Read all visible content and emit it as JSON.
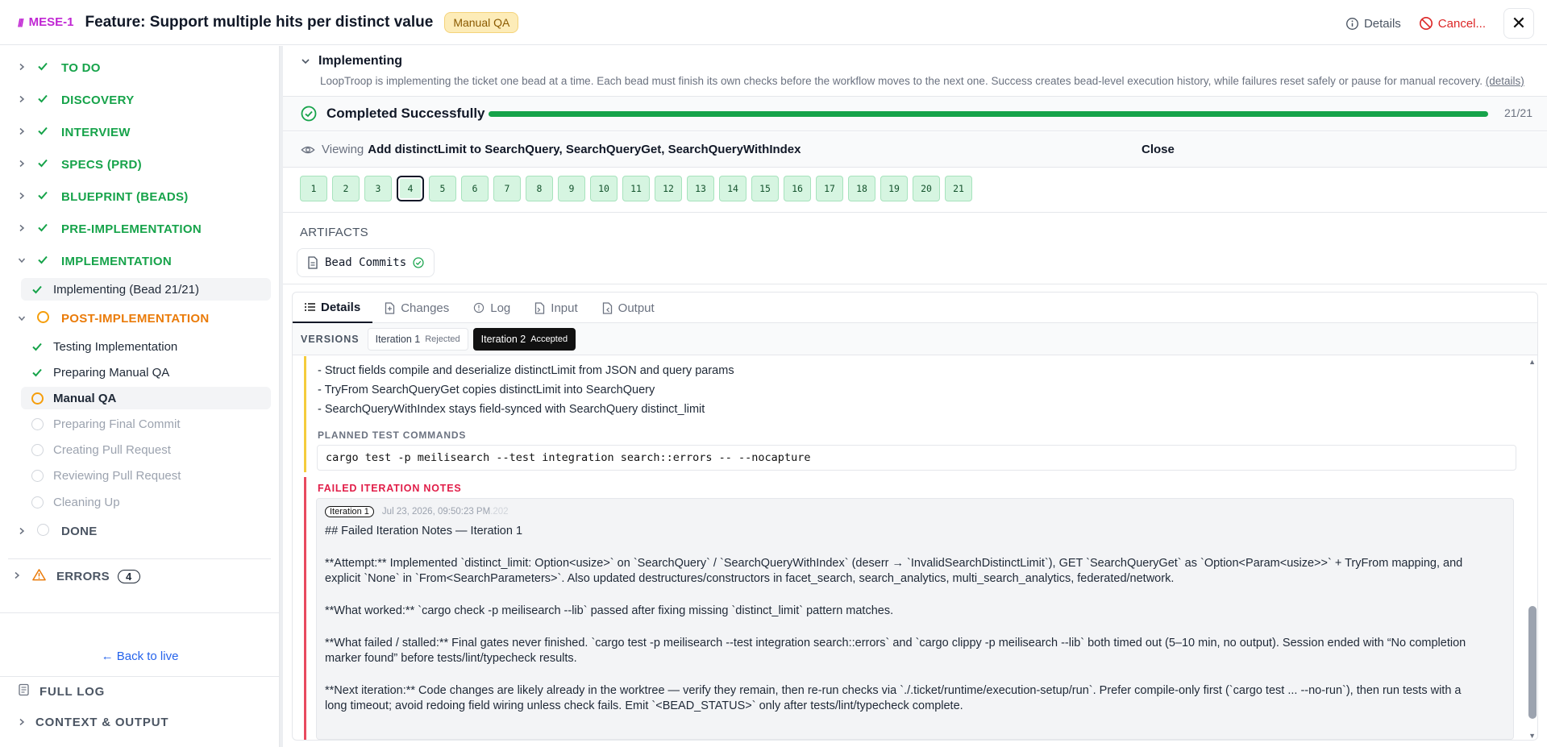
{
  "header": {
    "logo": "///",
    "ticket_id": "MESE-1",
    "title": "Feature: Support multiple hits per distinct value",
    "status": "Manual QA",
    "details_label": "Details",
    "cancel_label": "Cancel...",
    "close_glyph": "✕"
  },
  "sidebar": {
    "phases": [
      {
        "label": "TO DO",
        "state": "done"
      },
      {
        "label": "DISCOVERY",
        "state": "done"
      },
      {
        "label": "INTERVIEW",
        "state": "done"
      },
      {
        "label": "SPECS (PRD)",
        "state": "done"
      },
      {
        "label": "BLUEPRINT (BEADS)",
        "state": "done"
      },
      {
        "label": "PRE-IMPLEMENTATION",
        "state": "done"
      },
      {
        "label": "IMPLEMENTATION",
        "state": "done"
      }
    ],
    "implementation_sub": "Implementing (Bead 21/21)",
    "post_impl": {
      "label": "POST-IMPLEMENTATION",
      "items": [
        {
          "label": "Testing Implementation",
          "state": "done"
        },
        {
          "label": "Preparing Manual QA",
          "state": "done"
        },
        {
          "label": "Manual QA",
          "state": "current"
        },
        {
          "label": "Preparing Final Commit",
          "state": "pending"
        },
        {
          "label": "Creating Pull Request",
          "state": "pending"
        },
        {
          "label": "Reviewing Pull Request",
          "state": "pending"
        },
        {
          "label": "Cleaning Up",
          "state": "pending"
        }
      ]
    },
    "done_label": "DONE",
    "errors_label": "ERRORS",
    "errors_count": "4",
    "back_link": "← Back to live",
    "full_log": "FULL LOG",
    "context_output": "CONTEXT & OUTPUT"
  },
  "main": {
    "section_title": "Implementing",
    "section_desc": "LoopTroop is implementing the ticket one bead at a time. Each bead must finish its own checks before the workflow moves to the next one. Success creates bead-level execution history, while failures reset safely or pause for manual recovery.",
    "details_link": "(details)",
    "progress_label": "Completed Successfully",
    "progress_fraction": 1.0,
    "progress_count": "21/21",
    "viewing_label": "Viewing",
    "viewing_title": "Add distinctLimit to SearchQuery, SearchQueryGet, SearchQueryWithIndex",
    "viewing_close": "Close",
    "beads": [
      "1",
      "2",
      "3",
      "4",
      "5",
      "6",
      "7",
      "8",
      "9",
      "10",
      "11",
      "12",
      "13",
      "14",
      "15",
      "16",
      "17",
      "18",
      "19",
      "20",
      "21"
    ],
    "selected_bead": "4",
    "artifacts_label": "ARTIFACTS",
    "artifact_chip": "Bead Commits",
    "tabs": [
      "Details",
      "Changes",
      "Log",
      "Input",
      "Output"
    ],
    "versions_label": "VERSIONS",
    "versions": [
      {
        "label": "Iteration 1",
        "status": "Rejected"
      },
      {
        "label": "Iteration 2",
        "status": "Accepted"
      }
    ],
    "criteria": [
      "- Struct fields compile and deserialize distinctLimit from JSON and query params",
      "- TryFrom SearchQueryGet copies distinctLimit into SearchQuery",
      "- SearchQueryWithIndex stays field-synced with SearchQuery distinct_limit"
    ],
    "planned_label": "PLANNED TEST COMMANDS",
    "planned_cmd": "cargo test -p meilisearch --test integration search::errors -- --nocapture",
    "failed_label": "FAILED ITERATION NOTES",
    "note": {
      "badge": "Iteration 1",
      "date": "Jul 23, 2026, 09:50:23 PM",
      "date_ms": ".202",
      "heading": "## Failed Iteration Notes — Iteration 1",
      "attempt_1": "**Attempt:** Implemented `distinct_limit: Option<usize>` on `SearchQuery` / `SearchQueryWithIndex` (deserr → `InvalidSearchDistinctLimit`), GET `SearchQueryGet` as `Option<Param<usize>>` + TryFrom mapping, and",
      "attempt_2": "explicit `None` in `From<SearchParameters>`. Also updated destructures/constructors in facet_search, search_analytics, multi_search_analytics, federated/network.",
      "worked": "**What worked:** `cargo check -p meilisearch --lib` passed after fixing missing `distinct_limit` pattern matches.",
      "failed_1": "**What failed / stalled:** Final gates never finished. `cargo test -p meilisearch --test integration search::errors` and `cargo clippy -p meilisearch --lib` both timed out (5–10 min, no output). Session ended with “No completion",
      "failed_2": "marker found” before tests/lint/typecheck results.",
      "next_1": "**Next iteration:** Code changes are likely already in the worktree — verify they remain, then re-run checks via `./.ticket/runtime/execution-setup/run`. Prefer compile-only first (`cargo test ... --no-run`), then run tests with a",
      "next_2": "long timeout; avoid redoing field wiring unless check fails. Emit `<BEAD_STATUS>` only after tests/lint/typecheck complete."
    }
  },
  "colors": {
    "success": "#16a34a",
    "warning": "#ea7b09",
    "danger": "#dc2626",
    "accent": "#c026d3"
  }
}
